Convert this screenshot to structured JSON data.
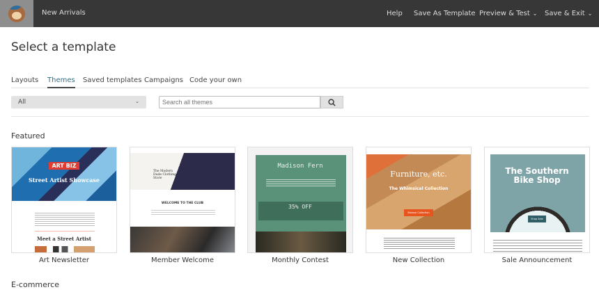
{
  "topbar": {
    "campaign_name": "New Arrivals",
    "nav": [
      {
        "label": "Help"
      },
      {
        "label": "Save As Template"
      },
      {
        "label": "Preview & Test",
        "dropdown": true
      },
      {
        "label": "Save & Exit",
        "dropdown": true
      }
    ]
  },
  "page_title": "Select a template",
  "tabs": [
    {
      "label": "Layouts"
    },
    {
      "label": "Themes",
      "active": true
    },
    {
      "label": "Saved templates"
    },
    {
      "label": "Campaigns"
    },
    {
      "label": "Code your own"
    }
  ],
  "filter": {
    "value": "All"
  },
  "search": {
    "placeholder": "Search all themes",
    "icon": "search-icon"
  },
  "sections": {
    "featured": "Featured",
    "ecommerce": "E-commerce"
  },
  "accent": "#2d6f8c",
  "themes": [
    {
      "name": "Art Newsletter",
      "logo": "ART BIZ",
      "headline": "Street Artist Showcase",
      "sub": "Meet a Street Artist"
    },
    {
      "name": "Member Welcome",
      "headline": "The Modern Dude Clothing Store",
      "sub": "WELCOME TO THE CLUB"
    },
    {
      "name": "Monthly Contest",
      "headline": "Madison Fern",
      "sub": "35% OFF"
    },
    {
      "name": "New Collection",
      "headline": "Furniture, etc.",
      "sub": "The Whimsical Collection",
      "button": "Browse Collection"
    },
    {
      "name": "Sale Announcement",
      "headline": "The Southern Bike Shop",
      "button": "Shop Sale"
    }
  ]
}
